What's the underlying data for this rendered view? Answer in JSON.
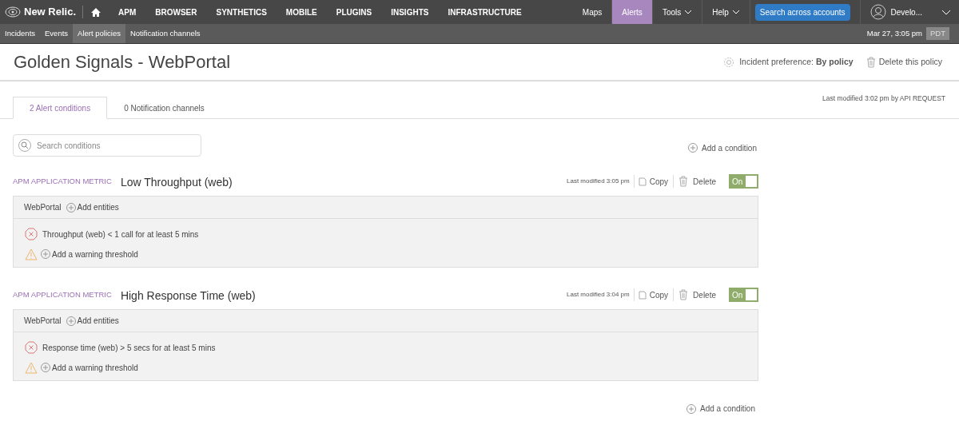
{
  "top_nav": {
    "logo": "New Relic.",
    "items": [
      {
        "label": "APM"
      },
      {
        "label": "BROWSER"
      },
      {
        "label": "SYNTHETICS"
      },
      {
        "label": "MOBILE"
      },
      {
        "label": "PLUGINS"
      },
      {
        "label": "INSIGHTS"
      },
      {
        "label": "INFRASTRUCTURE"
      }
    ],
    "right_items": [
      {
        "label": "Maps",
        "selected": false,
        "dropdown": false
      },
      {
        "label": "Alerts",
        "selected": true,
        "dropdown": false
      },
      {
        "label": "Tools",
        "selected": false,
        "dropdown": true
      },
      {
        "label": "Help",
        "selected": false,
        "dropdown": true
      }
    ],
    "search_button": "Search across accounts",
    "user": "Develo..."
  },
  "sub_nav": {
    "items": [
      {
        "label": "Incidents",
        "selected": false
      },
      {
        "label": "Events",
        "selected": false
      },
      {
        "label": "Alert policies",
        "selected": true
      },
      {
        "label": "Notification channels",
        "selected": false
      }
    ],
    "datetime": "Mar 27, 3:05 pm",
    "timezone": "PDT"
  },
  "header": {
    "title": "Golden Signals - WebPortal",
    "incident_preference": "Incident preference: **By policy**",
    "delete": "Delete this policy"
  },
  "tabs": [
    {
      "label": "2 Alert conditions",
      "selected": true
    },
    {
      "label": "0 Notification channels",
      "selected": false
    }
  ],
  "last_modified": "Last modified 3:02 pm by API REQUEST",
  "search": {
    "placeholder": "Search conditions"
  },
  "add_condition_top": "Add a condition",
  "conditions": [
    {
      "type": "APM APPLICATION METRIC",
      "name": "Low Throughput (web)",
      "modified": "Last modified 3:05 pm",
      "copy": "Copy",
      "delete": "Delete",
      "toggle": "On",
      "on": true,
      "entity": "WebPortal",
      "add_entities": "Add entities",
      "critical": "Throughput (web) < 1 call for at least 5 mins",
      "warning": "Add a warning threshold"
    },
    {
      "type": "APM APPLICATION METRIC",
      "name": "High Response Time (web)",
      "modified": "Last modified 3:04 pm",
      "copy": "Copy",
      "delete": "Delete",
      "toggle": "On",
      "on": true,
      "entity": "WebPortal",
      "add_entities": "Add entities",
      "critical": "Response time (web) > 5 secs for at least 5 mins",
      "warning": "Add a warning threshold"
    }
  ],
  "add_condition_bottom": "Add a condition"
}
